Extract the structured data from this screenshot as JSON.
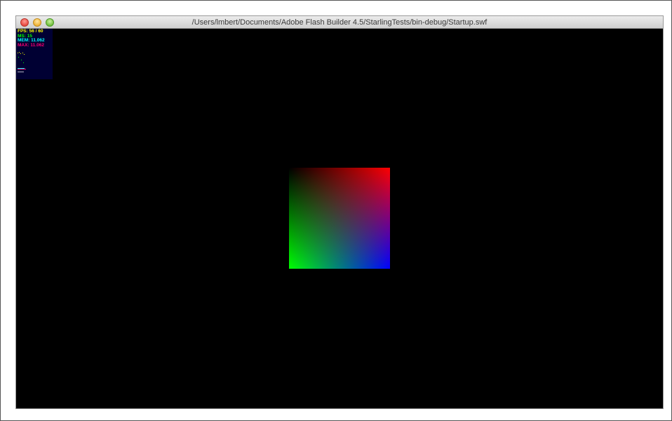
{
  "window": {
    "title": "/Users/lmbert/Documents/Adobe Flash Builder 4.5/StarlingTests/bin-debug/Startup.swf",
    "controls": {
      "close_icon": "close-icon",
      "minimize_icon": "minimize-icon",
      "maximize_icon": "maximize-icon"
    }
  },
  "stats": {
    "fps": "FPS: 56 / 60",
    "ms": "MS: 15",
    "mem": "MEM: 11.062",
    "max": "MAX: 11.062"
  },
  "colors": {
    "background": "#000000",
    "stats_background": "#000033",
    "fps": "#ffff00",
    "ms": "#00ff00",
    "mem": "#00ffff",
    "max": "#ff0070",
    "quad_top_left": "#000000",
    "quad_top_right": "#ff0000",
    "quad_bottom_left": "#00ff00",
    "quad_bottom_right": "#0000ff"
  }
}
